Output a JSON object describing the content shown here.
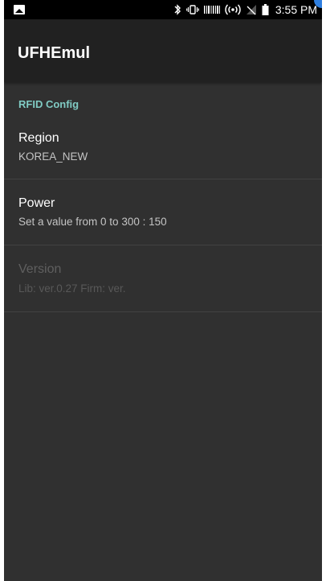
{
  "status_bar": {
    "time": "3:55 PM",
    "icons": [
      "image-icon",
      "bluetooth-icon",
      "vibrate-icon",
      "barcode-icon",
      "hotspot-icon",
      "no-signal-icon",
      "battery-icon"
    ]
  },
  "app_bar": {
    "title": "UFHEmul"
  },
  "preferences": {
    "category": "RFID Config",
    "items": [
      {
        "title": "Region",
        "summary": "KOREA_NEW",
        "enabled": true
      },
      {
        "title": "Power",
        "summary": "Set a value from 0 to 300 : 150",
        "enabled": true
      },
      {
        "title": "Version",
        "summary": "Lib: ver.0.27 Firm: ver.",
        "enabled": false
      }
    ]
  },
  "colors": {
    "background": "#303030",
    "app_bar": "#212121",
    "accent": "#80cbc4",
    "corner_indicator": "#2f7fe0"
  }
}
